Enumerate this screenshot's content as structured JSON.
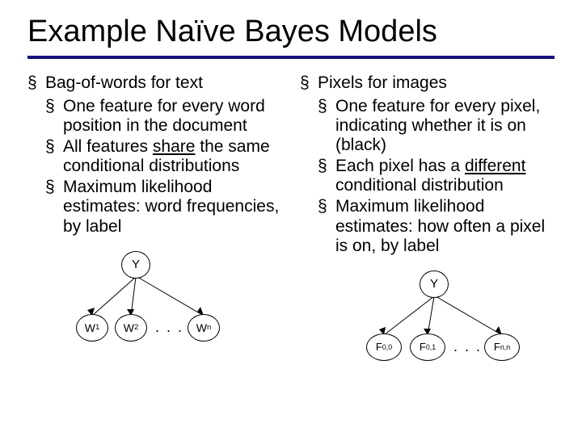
{
  "title": "Example Naïve Bayes Models",
  "left": {
    "heading": "Bag-of-words for text",
    "items": [
      "One feature for every word position in the document",
      "All features <span class=\"share\">share</span> the same conditional distributions",
      "Maximum likelihood estimates: word frequencies, by label"
    ],
    "diagram": {
      "root": "Y",
      "children": [
        "W<sub>1</sub>",
        "W<sub>2</sub>",
        "W<sub>n</sub>"
      ],
      "dots": ". . ."
    }
  },
  "right": {
    "heading": "Pixels for images",
    "items": [
      "One feature for every pixel, indicating whether it is on (black)",
      "Each pixel has a <span class=\"diff\">different</span> conditional distribution",
      "Maximum likelihood estimates: how often a pixel is on, by label"
    ],
    "diagram": {
      "root": "Y",
      "children": [
        "F<sub>0,0</sub>",
        "F<sub>0,1</sub>",
        "F<sub>n,n</sub>"
      ],
      "dots": ". . ."
    }
  }
}
